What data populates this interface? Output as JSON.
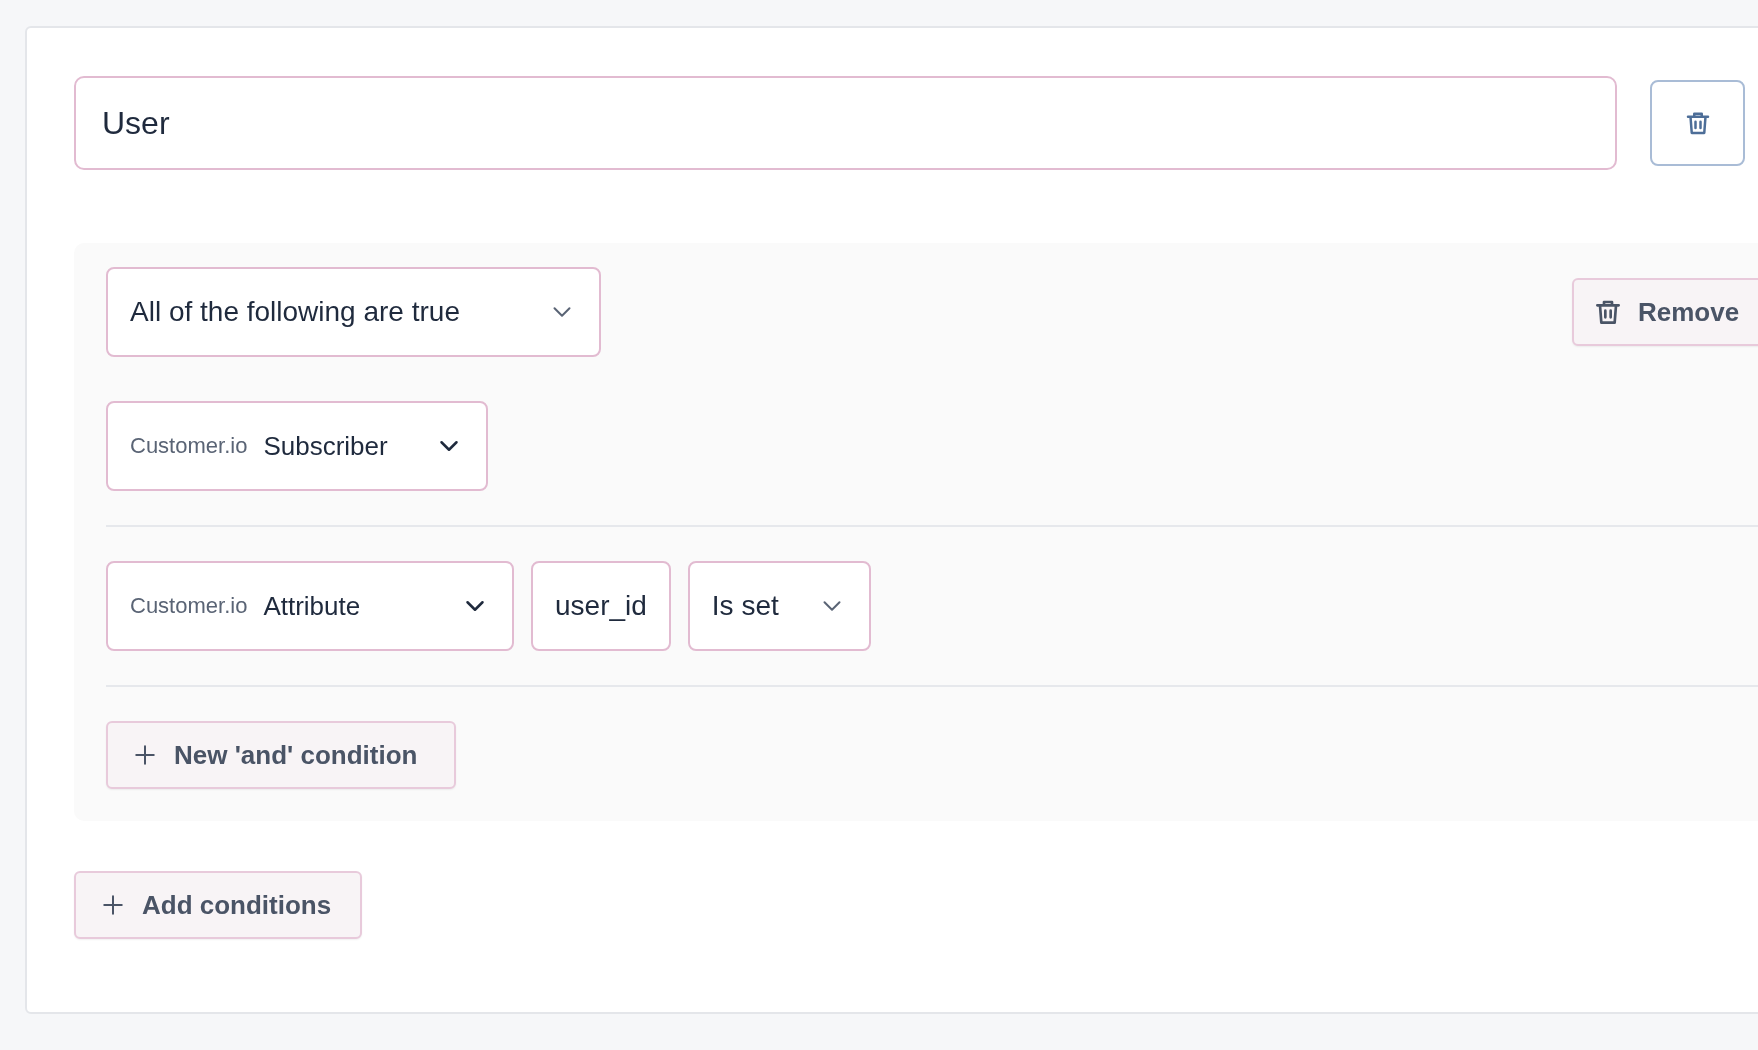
{
  "filter": {
    "name": "User",
    "group": {
      "match": "All of the following are true",
      "remove_label": "Remove",
      "conditions": [
        {
          "kind": "subscriber",
          "source": "Customer.io",
          "type": "Subscriber"
        },
        {
          "kind": "attribute",
          "source": "Customer.io",
          "type": "Attribute",
          "attribute": "user_id",
          "operator": "Is set"
        }
      ],
      "add_label": "New 'and' condition"
    },
    "add_conditions_label": "Add conditions"
  }
}
